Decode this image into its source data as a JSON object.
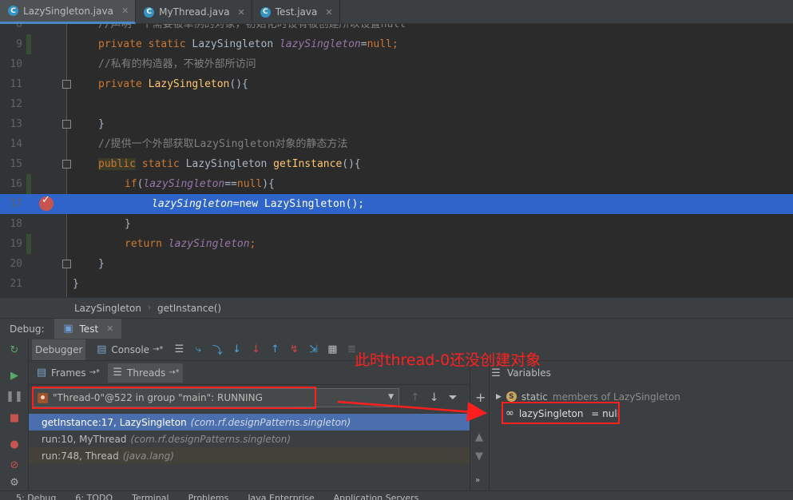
{
  "tabs": [
    {
      "label": "LazySingleton.java",
      "icon": "C",
      "active": true
    },
    {
      "label": "MyThread.java",
      "icon": "C",
      "active": false
    },
    {
      "label": "Test.java",
      "icon": "C",
      "active": false
    }
  ],
  "editor": {
    "lines": [
      {
        "num": "8",
        "text": "//声明一个需要被单例的对象，初始化时设有被创建所以设置null"
      },
      {
        "num": "9",
        "text": "private static LazySingleton lazySingleton=null;"
      },
      {
        "num": "10",
        "text": "//私有的构造器，不被外部所访问"
      },
      {
        "num": "11",
        "text": "private LazySingleton(){"
      },
      {
        "num": "12",
        "text": ""
      },
      {
        "num": "13",
        "text": "}"
      },
      {
        "num": "14",
        "text": "//提供一个外部获取LazySingleton对象的静态方法"
      },
      {
        "num": "15",
        "text": "public static LazySingleton getInstance(){"
      },
      {
        "num": "16",
        "text": "if(lazySingleton==null){"
      },
      {
        "num": "17",
        "text": "lazySingleton=new LazySingleton();"
      },
      {
        "num": "18",
        "text": "}"
      },
      {
        "num": "19",
        "text": "return lazySingleton;"
      },
      {
        "num": "20",
        "text": "}"
      },
      {
        "num": "21",
        "text": "}"
      }
    ]
  },
  "breadcrumb": {
    "class_name": "LazySingleton",
    "method_name": "getInstance()"
  },
  "debug": {
    "title": "Debug:",
    "session_tab": "Test",
    "debugger_tab": "Debugger",
    "console_tab": "Console",
    "frames_tab": "Frames",
    "threads_tab": "Threads",
    "thread_selected": "\"Thread-0\"@522 in group \"main\": RUNNING",
    "frames": [
      {
        "method": "getInstance:17, LazySingleton",
        "pkg": "(com.rf.designPatterns.singleton)"
      },
      {
        "method": "run:10, MyThread",
        "pkg": "(com.rf.designPatterns.singleton)"
      },
      {
        "method": "run:748, Thread",
        "pkg": "(java.lang)"
      }
    ],
    "variables_title": "Variables",
    "static_members_label": "static",
    "static_members_text": "members of LazySingleton",
    "variable_name": "lazySingleton",
    "variable_value": " = null"
  },
  "annotation": {
    "text": "此时thread-0还没创建对象",
    "color": "#ff2020"
  },
  "bottom_bar": [
    "5: Debug",
    "6: TODO",
    "Terminal",
    "Problems",
    "Java Enterprise",
    "Application Servers"
  ],
  "colors": {
    "keyword": "#cc7832",
    "field": "#9876aa",
    "comment": "#808080",
    "method": "#ffc66d",
    "execution_line": "#2f65ca",
    "selected_frame": "#4b6eaf"
  }
}
